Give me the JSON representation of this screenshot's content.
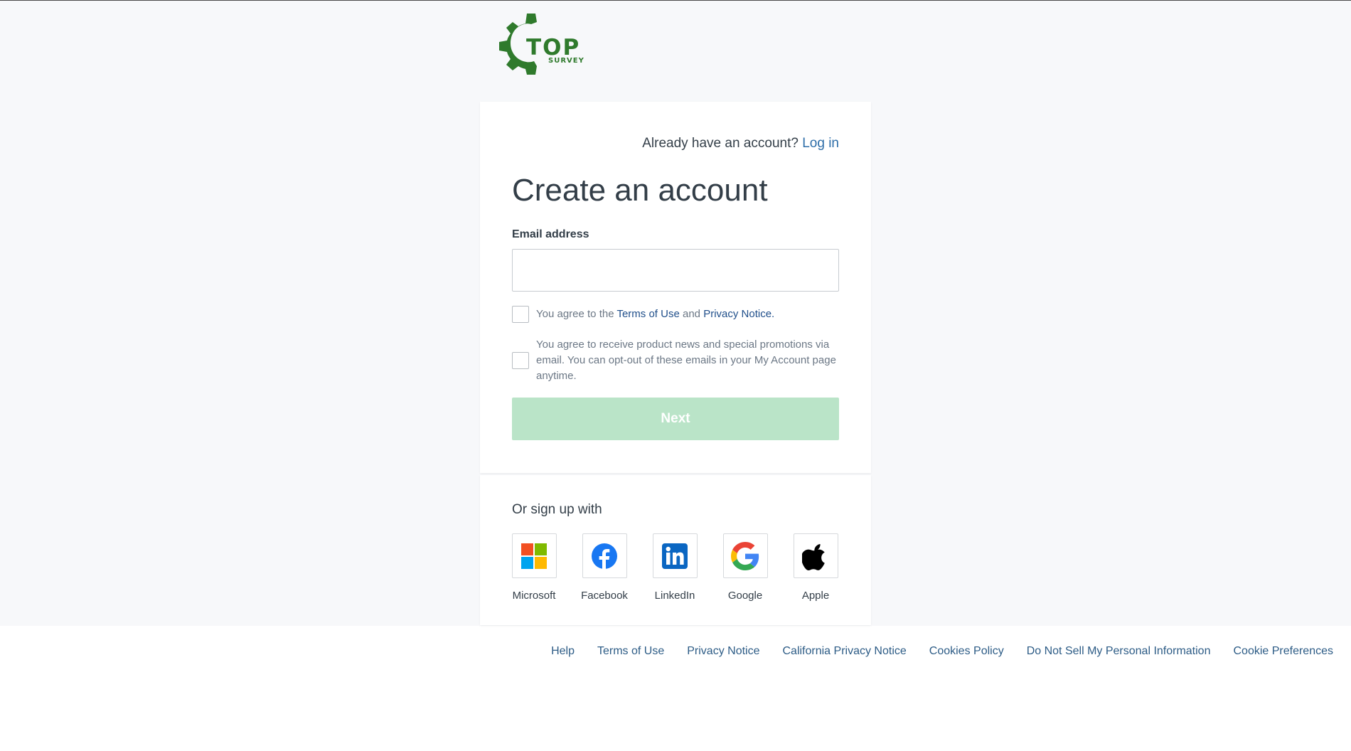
{
  "logo": {
    "word": "TOP",
    "sub": "SURVEY",
    "color": "#2f7a2c"
  },
  "header": {
    "already_text": "Already have an account?",
    "login_label": "Log in"
  },
  "form": {
    "title": "Create an account",
    "email_label": "Email address",
    "email_value": "",
    "email_placeholder": "",
    "terms": {
      "prefix": "You agree to the",
      "terms_link": "Terms of Use",
      "and": "and",
      "privacy_link": "Privacy Notice",
      "suffix": ".",
      "checked": false
    },
    "promo": {
      "text": "You agree to receive product news and special promotions via email. You can opt-out of these emails in your My Account page anytime.",
      "checked": false
    },
    "next_label": "Next",
    "next_color": "#bae4c8"
  },
  "social": {
    "heading": "Or sign up with",
    "providers": [
      {
        "name": "Microsoft",
        "icon": "microsoft-icon"
      },
      {
        "name": "Facebook",
        "icon": "facebook-icon"
      },
      {
        "name": "LinkedIn",
        "icon": "linkedin-icon"
      },
      {
        "name": "Google",
        "icon": "google-icon"
      },
      {
        "name": "Apple",
        "icon": "apple-icon"
      }
    ]
  },
  "footer": {
    "links": [
      "Help",
      "Terms of Use",
      "Privacy Notice",
      "California Privacy Notice",
      "Cookies Policy",
      "Do Not Sell My Personal Information",
      "Cookie Preferences"
    ]
  },
  "colors": {
    "link": "#2d6da8",
    "page_bg": "#f7f8fa",
    "text": "#333e48"
  }
}
